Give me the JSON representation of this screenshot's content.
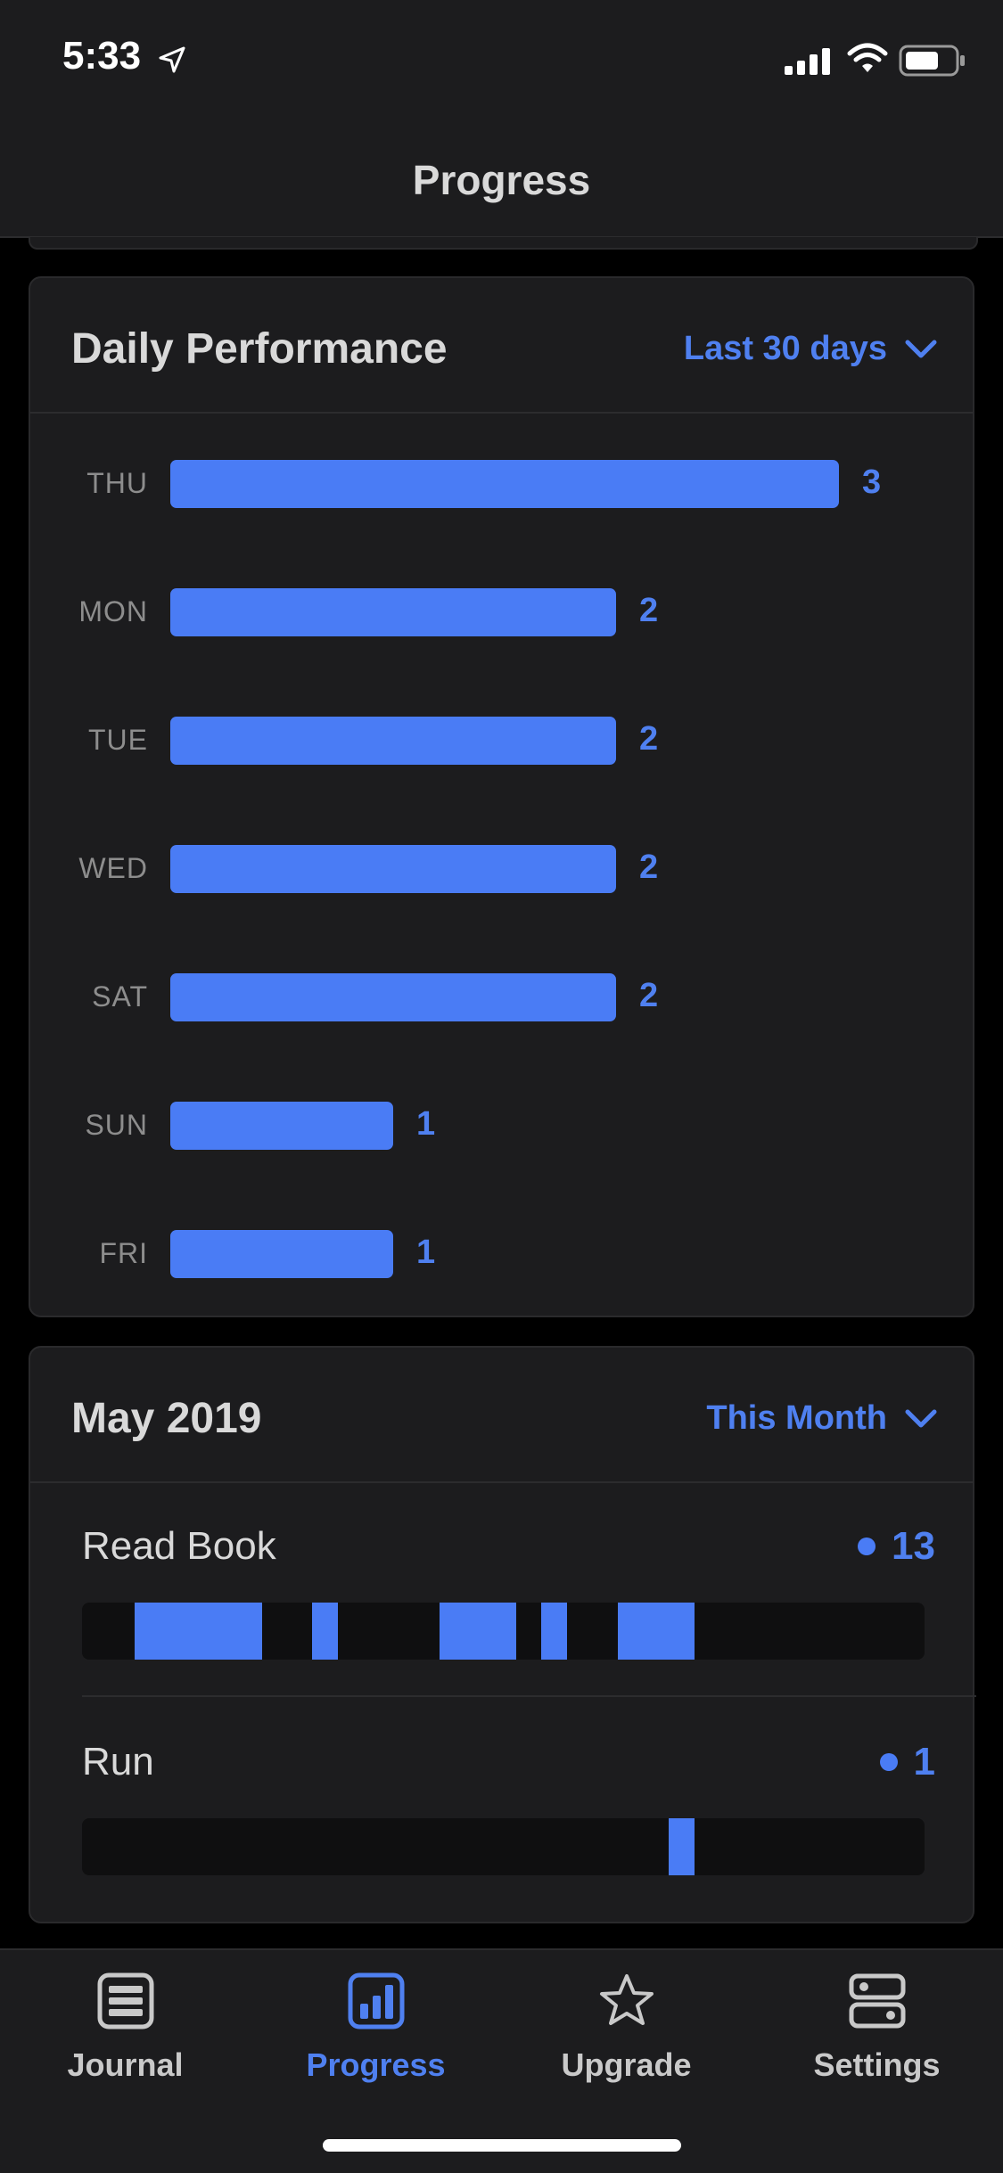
{
  "status_bar": {
    "time": "5:33",
    "icons": [
      "location-arrow-icon",
      "signal-icon",
      "wifi-icon",
      "battery-icon"
    ]
  },
  "nav": {
    "title": "Progress"
  },
  "daily_performance": {
    "title": "Daily Performance",
    "filter": "Last 30 days",
    "accent_color": "#4a7cf5",
    "rows": [
      {
        "day": "THU",
        "value": 3,
        "label": "3"
      },
      {
        "day": "MON",
        "value": 2,
        "label": "2"
      },
      {
        "day": "TUE",
        "value": 2,
        "label": "2"
      },
      {
        "day": "WED",
        "value": 2,
        "label": "2"
      },
      {
        "day": "SAT",
        "value": 2,
        "label": "2"
      },
      {
        "day": "SUN",
        "value": 1,
        "label": "1"
      },
      {
        "day": "FRI",
        "value": 1,
        "label": "1"
      }
    ]
  },
  "month": {
    "title": "May 2019",
    "filter": "This Month",
    "days_in_month": 31,
    "habits": [
      {
        "name": "Read Book",
        "count": "13",
        "completed_days": [
          2,
          3,
          4,
          5,
          6,
          9,
          14,
          15,
          16,
          18,
          21,
          22,
          23
        ]
      },
      {
        "name": "Run",
        "count": "1",
        "completed_days": [
          23
        ]
      }
    ]
  },
  "tabs": [
    {
      "label": "Journal",
      "icon": "journal-icon",
      "active": false
    },
    {
      "label": "Progress",
      "icon": "progress-chart-icon",
      "active": true
    },
    {
      "label": "Upgrade",
      "icon": "star-icon",
      "active": false
    },
    {
      "label": "Settings",
      "icon": "settings-icon",
      "active": false
    }
  ]
}
